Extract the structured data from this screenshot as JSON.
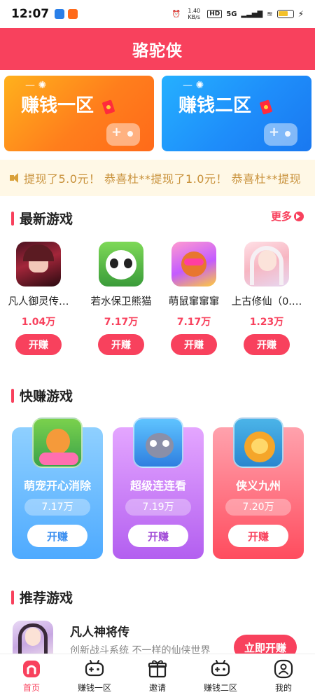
{
  "status_bar": {
    "time": "12:07",
    "net_speed": "1.40 KB/s",
    "hd": "HD",
    "network": "5G"
  },
  "header": {
    "title": "骆驼侠"
  },
  "zones": [
    {
      "label": "赚钱一区",
      "color": "#ff8a1c"
    },
    {
      "label": "赚钱二区",
      "color": "#1e8dfa"
    }
  ],
  "notice": {
    "text": "提现了5.0元！ 恭喜杜**提现了1.0元！ 恭喜杜**提现"
  },
  "newest": {
    "title": "最新游戏",
    "more": "更多",
    "games": [
      {
        "name": "凡人御灵传…",
        "count": "1.04万",
        "button": "开赚"
      },
      {
        "name": "若水保卫熊猫",
        "count": "7.17万",
        "button": "开赚"
      },
      {
        "name": "萌鼠窜窜窜",
        "count": "7.17万",
        "button": "开赚"
      },
      {
        "name": "上古修仙（0.…",
        "count": "1.23万",
        "button": "开赚"
      }
    ]
  },
  "quick": {
    "title": "快赚游戏",
    "games": [
      {
        "name": "萌宠开心消除",
        "count": "7.17万",
        "button": "开赚"
      },
      {
        "name": "超级连连看",
        "count": "7.19万",
        "button": "开赚"
      },
      {
        "name": "侠义九州",
        "count": "7.20万",
        "button": "开赚"
      }
    ]
  },
  "recommend": {
    "title": "推荐游戏",
    "name": "凡人神将传",
    "desc": "创新战斗系统 不一样的仙侠世界",
    "button": "立即开赚"
  },
  "tabs": [
    {
      "label": "首页",
      "icon": "home-icon",
      "active": true
    },
    {
      "label": "赚钱一区",
      "icon": "gamepad-icon",
      "active": false
    },
    {
      "label": "邀请",
      "icon": "gift-icon",
      "active": false
    },
    {
      "label": "赚钱二区",
      "icon": "gamepad-icon",
      "active": false
    },
    {
      "label": "我的",
      "icon": "profile-icon",
      "active": false
    }
  ],
  "colors": {
    "accent": "#f8415d",
    "notice_text": "#c8913a"
  }
}
